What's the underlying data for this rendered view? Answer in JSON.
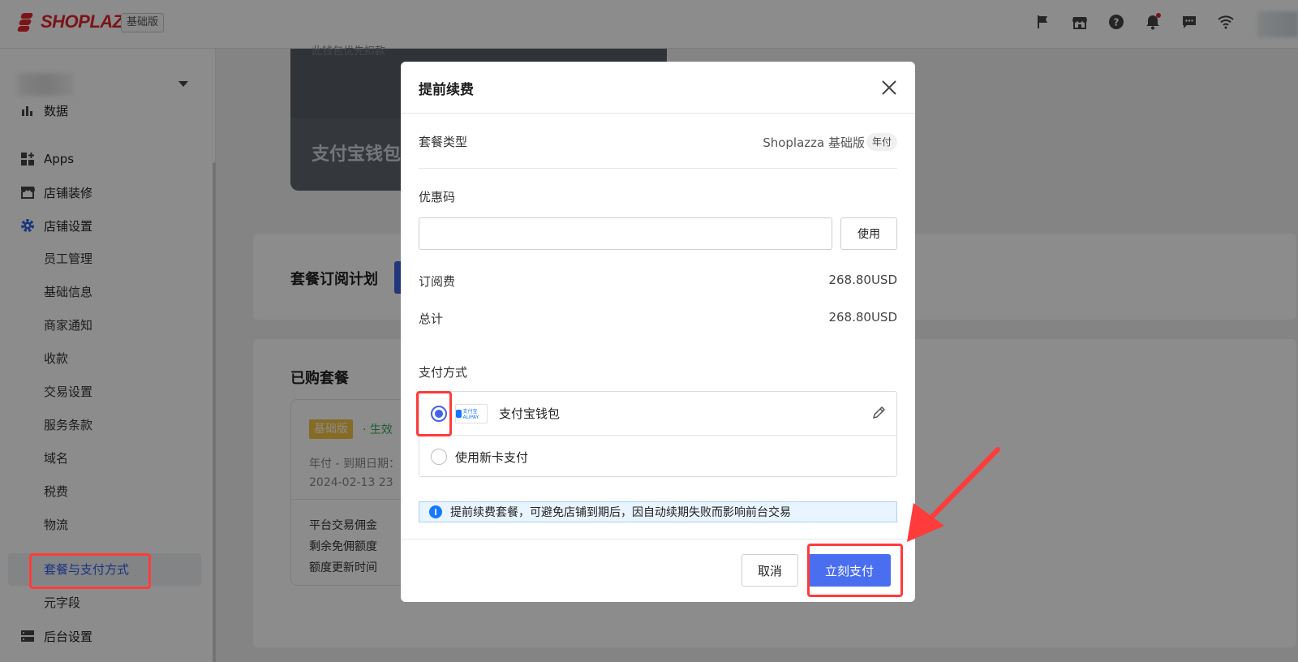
{
  "header": {
    "brand": "SHOPLAZZA",
    "plan_tag": "基础版",
    "icons": [
      "flag-icon",
      "store-icon",
      "help-icon",
      "bell-icon",
      "chat-icon",
      "wifi-icon"
    ]
  },
  "sidebar": {
    "items": [
      {
        "label": "数据",
        "icon": "bar-chart-icon"
      },
      {
        "label": "Apps",
        "icon": "apps-icon"
      },
      {
        "label": "店铺装修",
        "icon": "storefront-icon"
      },
      {
        "label": "店铺设置",
        "icon": "gear-icon"
      }
    ],
    "sub_items": [
      "员工管理",
      "基础信息",
      "商家通知",
      "收款",
      "交易设置",
      "服务条款",
      "域名",
      "税费",
      "物流",
      "套餐与支付方式",
      "元字段"
    ],
    "active_sub_item": "套餐与支付方式",
    "bottom_item": {
      "label": "后台设置",
      "icon": "server-icon"
    },
    "colors": {
      "active": "#2f5fe8"
    }
  },
  "main": {
    "wallet_card": {
      "faint_text": "此钱包优先扣款",
      "title": "支付宝钱包"
    },
    "subscription_plan_title": "套餐订阅计划",
    "purchased": {
      "title": "已购套餐",
      "badge": "基础版",
      "status": "· 生效",
      "line1": "年付 - 到期日期：",
      "line2": "2024-02-13 23",
      "stats": [
        "平台交易佣金",
        "剩余免佣额度",
        "额度更新时间"
      ]
    }
  },
  "modal": {
    "title": "提前续费",
    "package_type_label": "套餐类型",
    "package_type_value": "Shoplazza 基础版",
    "package_type_tag": "年付",
    "coupon_label": "优惠码",
    "coupon_value": "",
    "coupon_placeholder": "",
    "use_button": "使用",
    "subscription_fee_label": "订阅费",
    "subscription_fee_value": "268.80USD",
    "total_label": "总计",
    "total_value": "268.80USD",
    "payment_method_label": "支付方式",
    "payment_options": [
      {
        "label": "支付宝钱包",
        "selected": true,
        "logo_text": "支付宝 ALIPAY"
      },
      {
        "label": "使用新卡支付",
        "selected": false
      }
    ],
    "notice": "提前续费套餐，可避免店铺到期后，因自动续期失败而影响前台交易",
    "cancel_button": "取消",
    "pay_button": "立刻支付",
    "colors": {
      "primary": "#4a6ef0",
      "annotation": "#ff3b3b"
    }
  }
}
